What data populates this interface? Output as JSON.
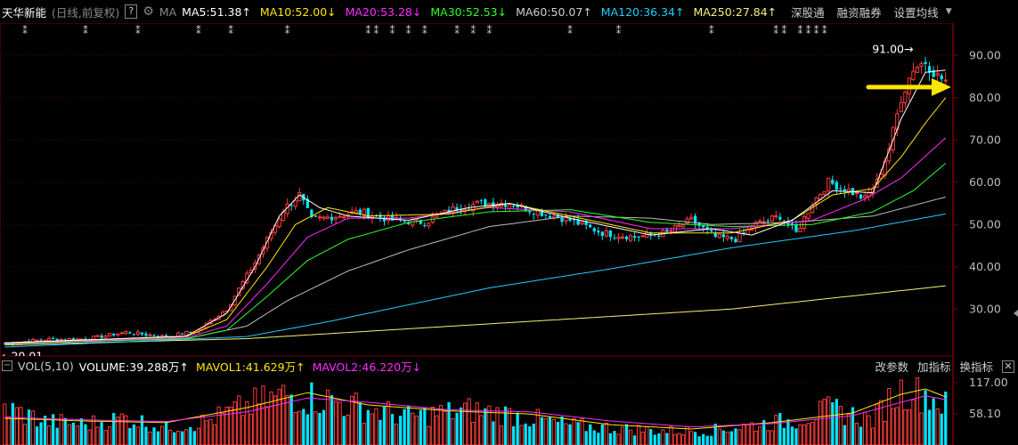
{
  "header": {
    "stock_name": "天华新能",
    "period": "(日线,前复权)",
    "help": "?",
    "ma_label": "MA",
    "ma": [
      {
        "text": "MA5:51.38↑",
        "color": "#ffffff"
      },
      {
        "text": "MA10:52.00↓",
        "color": "#ffe600"
      },
      {
        "text": "MA20:53.28↓",
        "color": "#ff2bff"
      },
      {
        "text": "MA30:52.53↓",
        "color": "#2bff2b"
      },
      {
        "text": "MA60:50.07↑",
        "color": "#cfcfcf"
      },
      {
        "text": "MA120:36.34↑",
        "color": "#22ccff"
      },
      {
        "text": "MA250:27.84↑",
        "color": "#f5f07a"
      }
    ],
    "actions": [
      "深股通",
      "融资融券",
      "设置均线"
    ]
  },
  "volume_header": {
    "minus": "−",
    "name": "VOL(5,10)",
    "items": [
      {
        "text": "VOLUME:39.288万↑",
        "color": "#ffffff"
      },
      {
        "text": "MAVOL1:41.629万↑",
        "color": "#ffe600"
      },
      {
        "text": "MAVOL2:46.220万↓",
        "color": "#ff2bff"
      }
    ],
    "actions": [
      "改参数",
      "加指标",
      "换指标"
    ],
    "close": "✕"
  },
  "colors": {
    "up": "#ff3c3c",
    "down": "#00e5ff",
    "axis": "#7a0000",
    "grid": "#3a0000",
    "ma5": "#ffffff",
    "ma10": "#ffe600",
    "ma20": "#ff2bff",
    "ma30": "#2bff2b",
    "ma60": "#bdbdbd",
    "ma120": "#22ccff",
    "ma250": "#f5f07a",
    "arrow": "#ffe600"
  },
  "chart_data": [
    {
      "type": "candlestick",
      "y_ticks": [
        "90.00",
        "80.00",
        "70.00",
        "60.00",
        "50.00",
        "40.00",
        "30.00"
      ],
      "y_tick_values": [
        90,
        80,
        70,
        60,
        50,
        40,
        30
      ],
      "ylim": [
        21,
        93
      ],
      "annotations": {
        "high_label": "91.00→",
        "high_value": 91.0,
        "low_label": "←20.01",
        "low_value": 20.01
      },
      "event_marker": "⁑",
      "event_marker_days": [
        5,
        20,
        33,
        48,
        56,
        70,
        90,
        92,
        96,
        100,
        104,
        112,
        116,
        120,
        140,
        152,
        175,
        191,
        193,
        197,
        199,
        201,
        203
      ],
      "close_series": [
        {
          "x": 0,
          "y": 21.8
        },
        {
          "x": 10,
          "y": 22.8
        },
        {
          "x": 20,
          "y": 22.9
        },
        {
          "x": 30,
          "y": 24.5
        },
        {
          "x": 40,
          "y": 23.4
        },
        {
          "x": 48,
          "y": 25.0
        },
        {
          "x": 55,
          "y": 30.0
        },
        {
          "x": 62,
          "y": 41.0
        },
        {
          "x": 69,
          "y": 53.5
        },
        {
          "x": 73,
          "y": 57.0
        },
        {
          "x": 76,
          "y": 51.0
        },
        {
          "x": 82,
          "y": 52.0
        },
        {
          "x": 88,
          "y": 53.0
        },
        {
          "x": 96,
          "y": 51.0
        },
        {
          "x": 104,
          "y": 50.5
        },
        {
          "x": 112,
          "y": 54.0
        },
        {
          "x": 118,
          "y": 55.0
        },
        {
          "x": 125,
          "y": 55.0
        },
        {
          "x": 132,
          "y": 53.0
        },
        {
          "x": 140,
          "y": 51.0
        },
        {
          "x": 148,
          "y": 48.0
        },
        {
          "x": 156,
          "y": 47.0
        },
        {
          "x": 164,
          "y": 48.0
        },
        {
          "x": 170,
          "y": 51.0
        },
        {
          "x": 176,
          "y": 47.0
        },
        {
          "x": 181,
          "y": 46.5
        },
        {
          "x": 186,
          "y": 50.0
        },
        {
          "x": 192,
          "y": 52.0
        },
        {
          "x": 196,
          "y": 48.0
        },
        {
          "x": 200,
          "y": 55.0
        },
        {
          "x": 204,
          "y": 60.0
        },
        {
          "x": 209,
          "y": 58.0
        },
        {
          "x": 213,
          "y": 56.0
        },
        {
          "x": 216,
          "y": 60.0
        },
        {
          "x": 219,
          "y": 68.0
        },
        {
          "x": 222,
          "y": 80.0
        },
        {
          "x": 225,
          "y": 87.0
        },
        {
          "x": 228,
          "y": 88.5
        },
        {
          "x": 231,
          "y": 85.0
        },
        {
          "x": 233,
          "y": 84.0
        }
      ],
      "series": [
        {
          "name": "MA250",
          "color_key": "ma250",
          "points": [
            {
              "x": 0,
              "y": 21.5
            },
            {
              "x": 60,
              "y": 23.0
            },
            {
              "x": 120,
              "y": 26.5
            },
            {
              "x": 180,
              "y": 30.0
            },
            {
              "x": 233,
              "y": 35.5
            }
          ]
        },
        {
          "name": "MA120",
          "color_key": "ma120",
          "points": [
            {
              "x": 0,
              "y": 21.0
            },
            {
              "x": 60,
              "y": 23.5
            },
            {
              "x": 80,
              "y": 27.0
            },
            {
              "x": 120,
              "y": 35.0
            },
            {
              "x": 150,
              "y": 39.5
            },
            {
              "x": 180,
              "y": 44.5
            },
            {
              "x": 210,
              "y": 48.5
            },
            {
              "x": 233,
              "y": 52.5
            }
          ]
        },
        {
          "name": "MA60",
          "color_key": "ma60",
          "points": [
            {
              "x": 0,
              "y": 21.8
            },
            {
              "x": 45,
              "y": 23.0
            },
            {
              "x": 60,
              "y": 26.0
            },
            {
              "x": 70,
              "y": 32.0
            },
            {
              "x": 85,
              "y": 39.0
            },
            {
              "x": 100,
              "y": 44.0
            },
            {
              "x": 120,
              "y": 49.5
            },
            {
              "x": 140,
              "y": 52.0
            },
            {
              "x": 160,
              "y": 51.5
            },
            {
              "x": 175,
              "y": 50.0
            },
            {
              "x": 195,
              "y": 50.5
            },
            {
              "x": 215,
              "y": 52.0
            },
            {
              "x": 233,
              "y": 56.5
            }
          ]
        },
        {
          "name": "MA30",
          "color_key": "ma30",
          "points": [
            {
              "x": 0,
              "y": 22.0
            },
            {
              "x": 45,
              "y": 23.0
            },
            {
              "x": 55,
              "y": 25.0
            },
            {
              "x": 65,
              "y": 33.0
            },
            {
              "x": 75,
              "y": 41.5
            },
            {
              "x": 85,
              "y": 46.5
            },
            {
              "x": 100,
              "y": 50.5
            },
            {
              "x": 120,
              "y": 53.0
            },
            {
              "x": 140,
              "y": 53.5
            },
            {
              "x": 160,
              "y": 50.5
            },
            {
              "x": 180,
              "y": 49.5
            },
            {
              "x": 200,
              "y": 50.0
            },
            {
              "x": 215,
              "y": 53.0
            },
            {
              "x": 225,
              "y": 58.0
            },
            {
              "x": 233,
              "y": 64.5
            }
          ]
        },
        {
          "name": "MA20",
          "color_key": "ma20",
          "points": [
            {
              "x": 0,
              "y": 22.0
            },
            {
              "x": 45,
              "y": 23.2
            },
            {
              "x": 55,
              "y": 26.0
            },
            {
              "x": 65,
              "y": 36.0
            },
            {
              "x": 75,
              "y": 47.0
            },
            {
              "x": 85,
              "y": 51.5
            },
            {
              "x": 100,
              "y": 51.5
            },
            {
              "x": 120,
              "y": 54.0
            },
            {
              "x": 140,
              "y": 53.0
            },
            {
              "x": 160,
              "y": 49.0
            },
            {
              "x": 180,
              "y": 49.0
            },
            {
              "x": 200,
              "y": 51.0
            },
            {
              "x": 213,
              "y": 56.0
            },
            {
              "x": 222,
              "y": 61.0
            },
            {
              "x": 233,
              "y": 70.5
            }
          ]
        },
        {
          "name": "MA10",
          "color_key": "ma10",
          "points": [
            {
              "x": 0,
              "y": 22.0
            },
            {
              "x": 45,
              "y": 23.5
            },
            {
              "x": 55,
              "y": 27.5
            },
            {
              "x": 65,
              "y": 40.0
            },
            {
              "x": 72,
              "y": 50.0
            },
            {
              "x": 80,
              "y": 54.0
            },
            {
              "x": 90,
              "y": 52.0
            },
            {
              "x": 110,
              "y": 52.5
            },
            {
              "x": 125,
              "y": 55.0
            },
            {
              "x": 140,
              "y": 52.0
            },
            {
              "x": 160,
              "y": 48.0
            },
            {
              "x": 180,
              "y": 48.0
            },
            {
              "x": 195,
              "y": 51.0
            },
            {
              "x": 205,
              "y": 57.0
            },
            {
              "x": 215,
              "y": 58.5
            },
            {
              "x": 222,
              "y": 66.0
            },
            {
              "x": 228,
              "y": 74.0
            },
            {
              "x": 233,
              "y": 80.0
            }
          ]
        },
        {
          "name": "MA5",
          "color_key": "ma5",
          "points": [
            {
              "x": 0,
              "y": 22.0
            },
            {
              "x": 45,
              "y": 23.6
            },
            {
              "x": 55,
              "y": 29.0
            },
            {
              "x": 62,
              "y": 40.0
            },
            {
              "x": 68,
              "y": 52.0
            },
            {
              "x": 73,
              "y": 57.0
            },
            {
              "x": 78,
              "y": 54.0
            },
            {
              "x": 85,
              "y": 52.0
            },
            {
              "x": 100,
              "y": 51.0
            },
            {
              "x": 115,
              "y": 54.0
            },
            {
              "x": 125,
              "y": 55.0
            },
            {
              "x": 140,
              "y": 51.5
            },
            {
              "x": 160,
              "y": 47.5
            },
            {
              "x": 175,
              "y": 49.0
            },
            {
              "x": 185,
              "y": 47.5
            },
            {
              "x": 195,
              "y": 51.0
            },
            {
              "x": 205,
              "y": 58.0
            },
            {
              "x": 215,
              "y": 57.5
            },
            {
              "x": 222,
              "y": 75.0
            },
            {
              "x": 228,
              "y": 86.0
            },
            {
              "x": 233,
              "y": 86.5
            }
          ]
        }
      ]
    },
    {
      "type": "bar",
      "y_ticks": [
        "117.00",
        "58.10"
      ],
      "y_tick_values": [
        117,
        58.1
      ],
      "ylim": [
        0,
        130
      ],
      "volume_series": [
        {
          "x": 0,
          "y": 75
        },
        {
          "x": 10,
          "y": 48
        },
        {
          "x": 20,
          "y": 42
        },
        {
          "x": 30,
          "y": 55
        },
        {
          "x": 40,
          "y": 35
        },
        {
          "x": 50,
          "y": 48
        },
        {
          "x": 60,
          "y": 78
        },
        {
          "x": 70,
          "y": 102
        },
        {
          "x": 78,
          "y": 95
        },
        {
          "x": 90,
          "y": 72
        },
        {
          "x": 100,
          "y": 58
        },
        {
          "x": 115,
          "y": 70
        },
        {
          "x": 125,
          "y": 62
        },
        {
          "x": 140,
          "y": 40
        },
        {
          "x": 155,
          "y": 32
        },
        {
          "x": 165,
          "y": 28
        },
        {
          "x": 175,
          "y": 30
        },
        {
          "x": 185,
          "y": 40
        },
        {
          "x": 195,
          "y": 50
        },
        {
          "x": 205,
          "y": 72
        },
        {
          "x": 215,
          "y": 50
        },
        {
          "x": 220,
          "y": 100
        },
        {
          "x": 225,
          "y": 118
        },
        {
          "x": 230,
          "y": 95
        },
        {
          "x": 233,
          "y": 80
        }
      ],
      "mavol_series": [
        {
          "name": "MAVOL1",
          "color_key": "ma10",
          "points": [
            {
              "x": 0,
              "y": 50
            },
            {
              "x": 20,
              "y": 45
            },
            {
              "x": 40,
              "y": 42
            },
            {
              "x": 60,
              "y": 70
            },
            {
              "x": 75,
              "y": 98
            },
            {
              "x": 90,
              "y": 75
            },
            {
              "x": 110,
              "y": 64
            },
            {
              "x": 130,
              "y": 58
            },
            {
              "x": 150,
              "y": 38
            },
            {
              "x": 170,
              "y": 30
            },
            {
              "x": 190,
              "y": 42
            },
            {
              "x": 210,
              "y": 60
            },
            {
              "x": 222,
              "y": 95
            },
            {
              "x": 228,
              "y": 105
            },
            {
              "x": 233,
              "y": 90
            }
          ]
        },
        {
          "name": "MAVOL2",
          "color_key": "ma20",
          "points": [
            {
              "x": 0,
              "y": 52
            },
            {
              "x": 20,
              "y": 47
            },
            {
              "x": 40,
              "y": 44
            },
            {
              "x": 60,
              "y": 62
            },
            {
              "x": 75,
              "y": 88
            },
            {
              "x": 90,
              "y": 80
            },
            {
              "x": 110,
              "y": 66
            },
            {
              "x": 130,
              "y": 62
            },
            {
              "x": 150,
              "y": 45
            },
            {
              "x": 170,
              "y": 34
            },
            {
              "x": 190,
              "y": 40
            },
            {
              "x": 210,
              "y": 55
            },
            {
              "x": 222,
              "y": 80
            },
            {
              "x": 228,
              "y": 92
            },
            {
              "x": 233,
              "y": 85
            }
          ]
        }
      ]
    }
  ]
}
